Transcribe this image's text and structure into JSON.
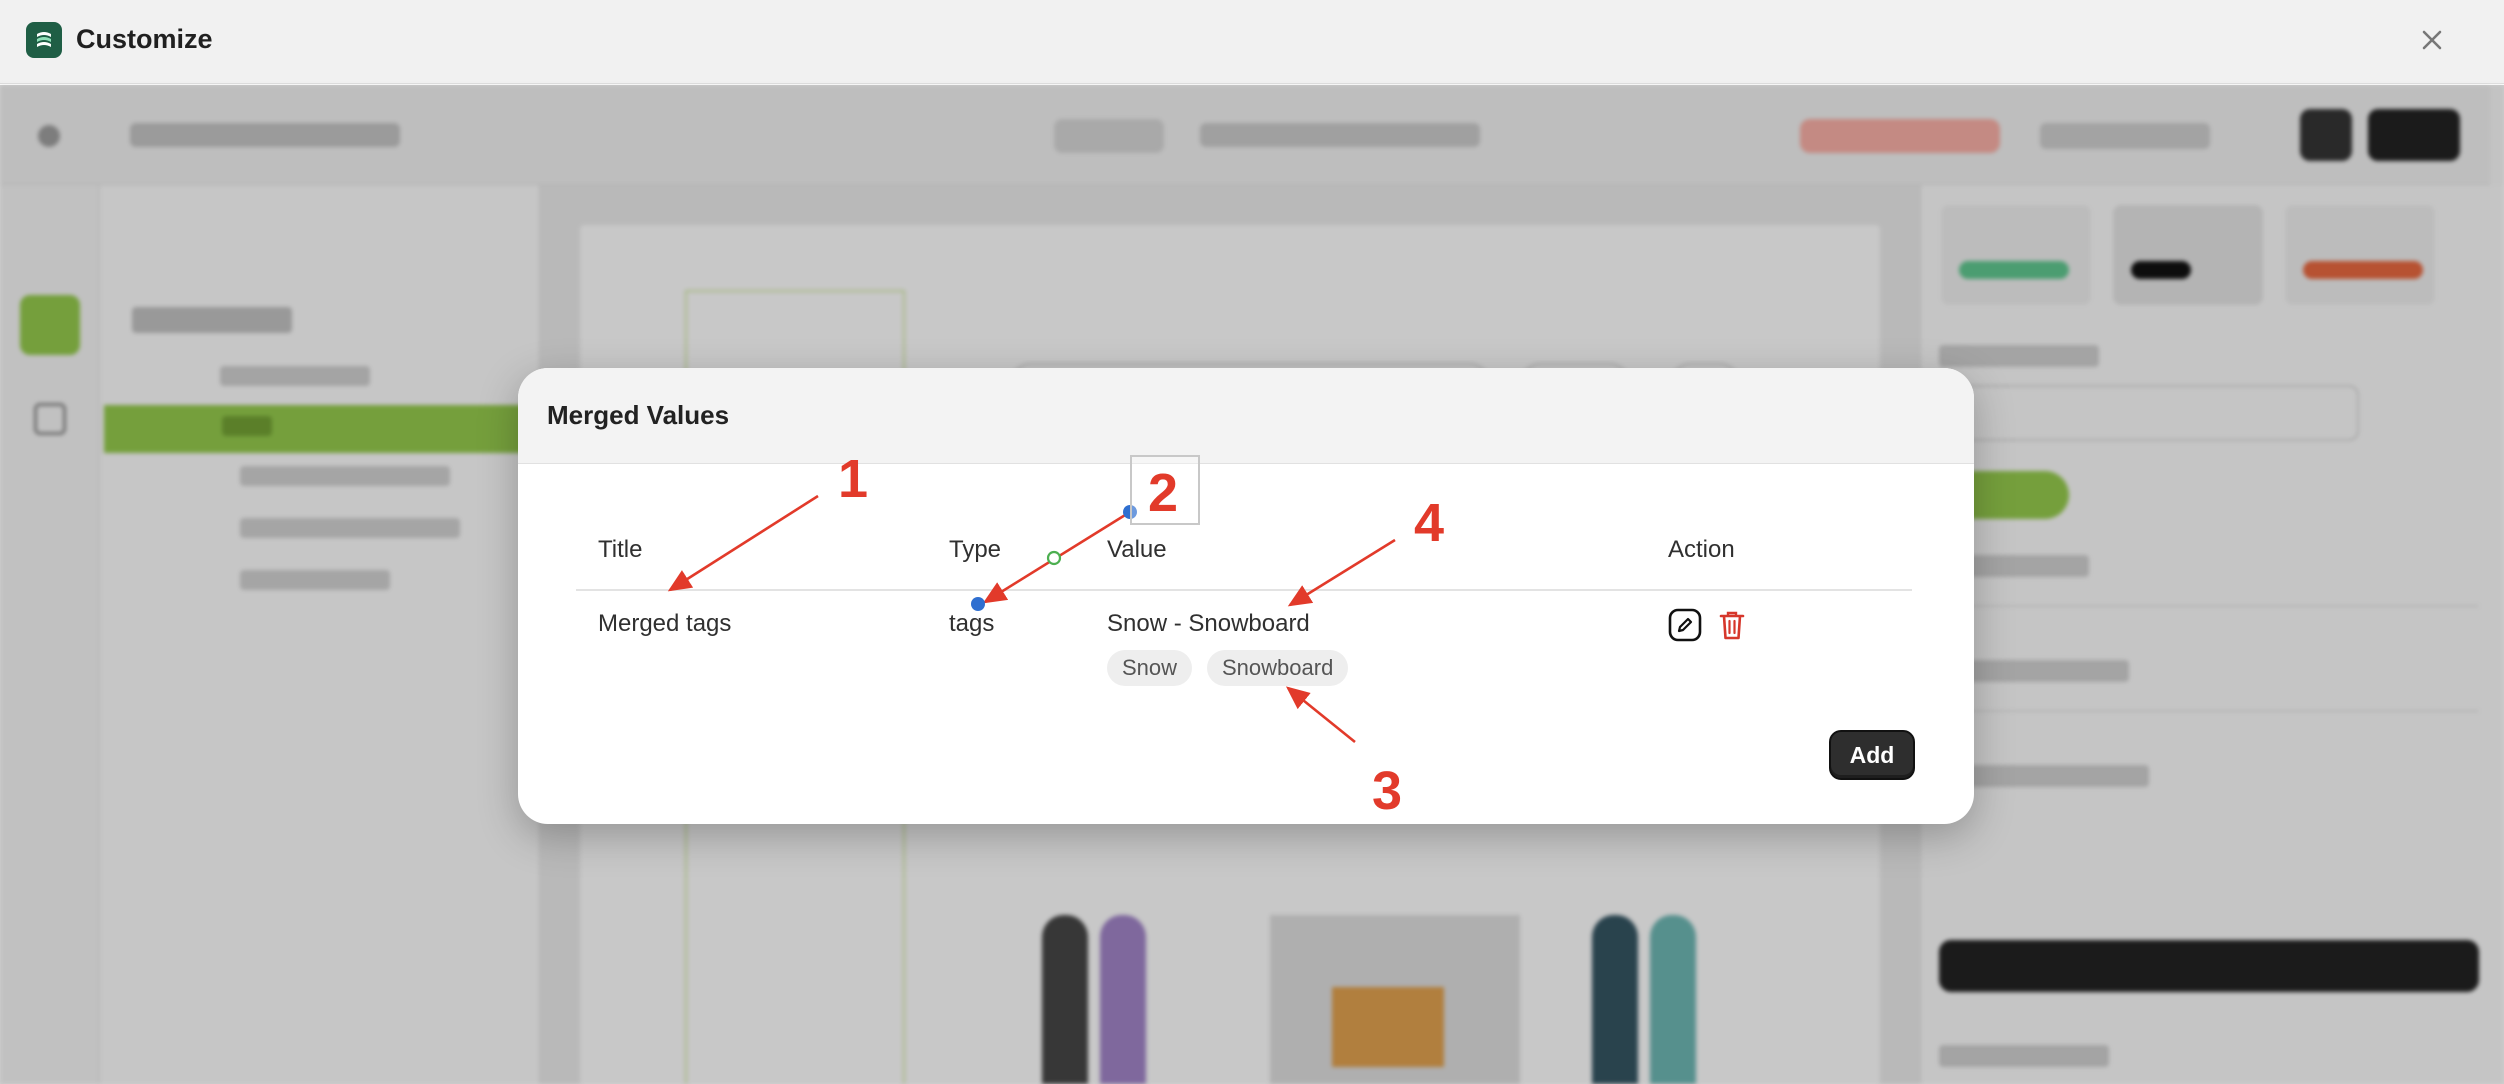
{
  "window": {
    "title": "Customize",
    "icons": {
      "logo": "app-logo-icon",
      "close": "close-icon"
    }
  },
  "modal": {
    "title": "Merged Values",
    "columns": [
      "Title",
      "Type",
      "Value",
      "Action"
    ],
    "rows": [
      {
        "title": "Merged tags",
        "type": "tags",
        "value": "Snow - Snowboard",
        "chips": [
          "Snow",
          "Snowboard"
        ],
        "actions": [
          "edit-icon",
          "trash-icon"
        ]
      }
    ],
    "add_label": "Add"
  },
  "annotations": {
    "labels": [
      "1",
      "2",
      "3",
      "4"
    ],
    "color": "#e23a2a"
  },
  "colors": {
    "accent_green": "#8fc34a",
    "delete_red": "#d6372b",
    "dark_button": "#2e2e2e"
  }
}
